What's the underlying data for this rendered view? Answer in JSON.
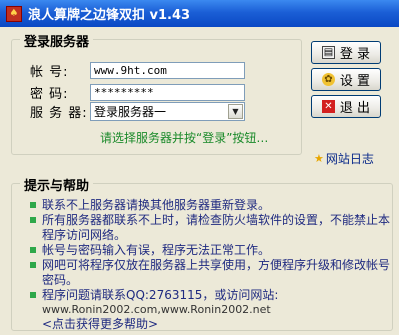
{
  "window": {
    "title": "浪人算牌之边锋双扣 v1.43"
  },
  "login": {
    "legend": "登录服务器",
    "account_label": "帐    号:",
    "account_value": "www.9ht.com",
    "password_label": "密    码:",
    "password_value": "*********",
    "server_label": "服 务 器:",
    "server_value": "登录服务器一",
    "hint": "请选择服务器并按“登录”按钮…"
  },
  "buttons": {
    "login": "登 录",
    "settings": "设 置",
    "exit": "退 出"
  },
  "website_log": "网站日志",
  "help": {
    "legend": "提示与帮助",
    "items": [
      "联系不上服务器请换其他服务器重新登录。",
      "所有服务器都联系不上时，请检查防火墙软件的设置，不能禁止本程序访问网络。",
      "帐号与密码输入有误，程序无法正常工作。",
      "网吧可将程序仅放在服务器上共享使用，方便程序升级和修改帐号密码。",
      "程序问题请联系QQ:2763115，或访问网站:"
    ],
    "url_line": "www.Ronin2002.com,www.Ronin2002.net",
    "more": "<点击获得更多帮助>"
  },
  "colors": {
    "hint": "#1a8a2a",
    "titlebar": "#1b5fd6",
    "bullet": "#2ea84a"
  }
}
